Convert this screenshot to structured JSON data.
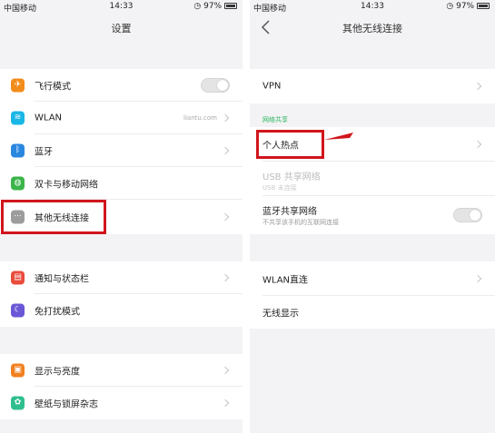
{
  "colors": {
    "highlight": "#d0161c",
    "section_accent": "#2db55d",
    "airplane_icon": "#f28c1a",
    "wlan_icon": "#1ab6e6",
    "bluetooth_icon": "#2a87e0",
    "dual_sim_icon": "#3bb54a",
    "other_wireless_icon": "#9c9c9c",
    "dnd_icon": "#6a57d6",
    "display_icon": "#f08020",
    "wallpaper_icon": "#2fbf8f"
  },
  "left": {
    "status": {
      "carrier": "中国移动",
      "time": "14:33",
      "battery": "97%"
    },
    "title": "设置",
    "items": [
      {
        "label": "飞行模式",
        "icon": "airplane-icon",
        "control": "toggle",
        "state": "off"
      },
      {
        "label": "WLAN",
        "icon": "wifi-icon",
        "value": "liantu.com"
      },
      {
        "label": "蓝牙",
        "icon": "bluetooth-icon"
      },
      {
        "label": "双卡与移动网络",
        "icon": "globe-icon"
      },
      {
        "label": "其他无线连接",
        "icon": "more-dots-icon",
        "highlighted": true
      },
      {
        "label": "通知与状态栏",
        "icon": "notification-icon"
      },
      {
        "label": "免打扰模式",
        "icon": "moon-icon"
      },
      {
        "label": "显示与亮度",
        "icon": "display-icon"
      },
      {
        "label": "壁纸与锁屏杂志",
        "icon": "flower-icon"
      }
    ]
  },
  "right": {
    "status": {
      "carrier": "中国移动",
      "time": "14:33",
      "battery": "97%"
    },
    "title": "其他无线连接",
    "section_header": "网络共享",
    "items": [
      {
        "label": "VPN"
      },
      {
        "label": "个人热点",
        "highlighted": true
      },
      {
        "label": "USB 共享网络",
        "sub": "USB 未连接",
        "disabled": true
      },
      {
        "label": "蓝牙共享网络",
        "sub": "不共享该手机的互联网连接",
        "control": "toggle",
        "state": "off"
      },
      {
        "label": "WLAN直连"
      },
      {
        "label": "无线显示"
      }
    ]
  }
}
